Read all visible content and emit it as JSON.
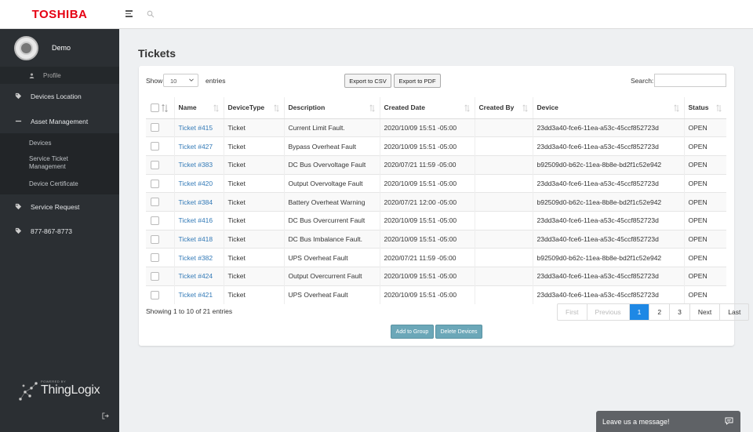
{
  "brand": {
    "logo_text": "TOSHIBA"
  },
  "user": {
    "name": "Demo"
  },
  "sidebar": {
    "profile_label": "Profile",
    "items": [
      {
        "label": "Devices Location",
        "icon": "tag-icon"
      },
      {
        "label": "Asset Management",
        "icon": "minus-icon"
      },
      {
        "label": "Service Request",
        "icon": "tag-icon"
      },
      {
        "label": "877-867-8773",
        "icon": "tag-icon"
      }
    ],
    "sub_items": [
      {
        "label": "Devices"
      },
      {
        "label": "Service Ticket Management"
      },
      {
        "label": "Device Certificate"
      }
    ],
    "powered_by": "POWERED BY",
    "powered_logo": "ThingLogix"
  },
  "page": {
    "title": "Tickets"
  },
  "controls": {
    "show_label": "Show",
    "page_size": "10",
    "entries_label": "entries",
    "export_csv": "Export to CSV",
    "export_pdf": "Export to PDF",
    "search_label": "Search:"
  },
  "table": {
    "columns": [
      "Name",
      "DeviceType",
      "Description",
      "Created Date",
      "Created By",
      "Device",
      "Status"
    ],
    "rows": [
      {
        "name": "Ticket #415",
        "type": "Ticket",
        "description": "Current Limit Fault.",
        "created": "2020/10/09 15:51 -05:00",
        "by": "",
        "device": "23dd3a40-fce6-11ea-a53c-45ccf852723d",
        "status": "OPEN"
      },
      {
        "name": "Ticket #427",
        "type": "Ticket",
        "description": "Bypass Overheat Fault",
        "created": "2020/10/09 15:51 -05:00",
        "by": "",
        "device": "23dd3a40-fce6-11ea-a53c-45ccf852723d",
        "status": "OPEN"
      },
      {
        "name": "Ticket #383",
        "type": "Ticket",
        "description": "DC Bus Overvoltage Fault",
        "created": "2020/07/21 11:59 -05:00",
        "by": "",
        "device": "b92509d0-b62c-11ea-8b8e-bd2f1c52e942",
        "status": "OPEN"
      },
      {
        "name": "Ticket #420",
        "type": "Ticket",
        "description": "Output Overvoltage Fault",
        "created": "2020/10/09 15:51 -05:00",
        "by": "",
        "device": "23dd3a40-fce6-11ea-a53c-45ccf852723d",
        "status": "OPEN"
      },
      {
        "name": "Ticket #384",
        "type": "Ticket",
        "description": "Battery Overheat Warning",
        "created": "2020/07/21 12:00 -05:00",
        "by": "",
        "device": "b92509d0-b62c-11ea-8b8e-bd2f1c52e942",
        "status": "OPEN"
      },
      {
        "name": "Ticket #416",
        "type": "Ticket",
        "description": "DC Bus Overcurrent Fault",
        "created": "2020/10/09 15:51 -05:00",
        "by": "",
        "device": "23dd3a40-fce6-11ea-a53c-45ccf852723d",
        "status": "OPEN"
      },
      {
        "name": "Ticket #418",
        "type": "Ticket",
        "description": "DC Bus Imbalance Fault.",
        "created": "2020/10/09 15:51 -05:00",
        "by": "",
        "device": "23dd3a40-fce6-11ea-a53c-45ccf852723d",
        "status": "OPEN"
      },
      {
        "name": "Ticket #382",
        "type": "Ticket",
        "description": "UPS Overheat Fault",
        "created": "2020/07/21 11:59 -05:00",
        "by": "",
        "device": "b92509d0-b62c-11ea-8b8e-bd2f1c52e942",
        "status": "OPEN"
      },
      {
        "name": "Ticket #424",
        "type": "Ticket",
        "description": "Output Overcurrent Fault",
        "created": "2020/10/09 15:51 -05:00",
        "by": "",
        "device": "23dd3a40-fce6-11ea-a53c-45ccf852723d",
        "status": "OPEN"
      },
      {
        "name": "Ticket #421",
        "type": "Ticket",
        "description": "UPS Overheat Fault",
        "created": "2020/10/09 15:51 -05:00",
        "by": "",
        "device": "23dd3a40-fce6-11ea-a53c-45ccf852723d",
        "status": "OPEN"
      }
    ]
  },
  "footer": {
    "info": "Showing 1 to 10 of 21 entries",
    "pagination": [
      {
        "label": "First",
        "state": "disabled"
      },
      {
        "label": "Previous",
        "state": "disabled"
      },
      {
        "label": "1",
        "state": "active"
      },
      {
        "label": "2",
        "state": "normal"
      },
      {
        "label": "3",
        "state": "normal"
      },
      {
        "label": "Next",
        "state": "normal"
      },
      {
        "label": "Last",
        "state": "normal"
      }
    ],
    "add_to_group": "Add to Group",
    "delete_devices": "Delete Devices"
  },
  "chat": {
    "label": "Leave us a message!"
  },
  "colors": {
    "brand": "#e60012",
    "sidebar": "#2b2f33",
    "accent": "#1e88e5",
    "link": "#337ab7",
    "action": "#6ba7b8"
  }
}
